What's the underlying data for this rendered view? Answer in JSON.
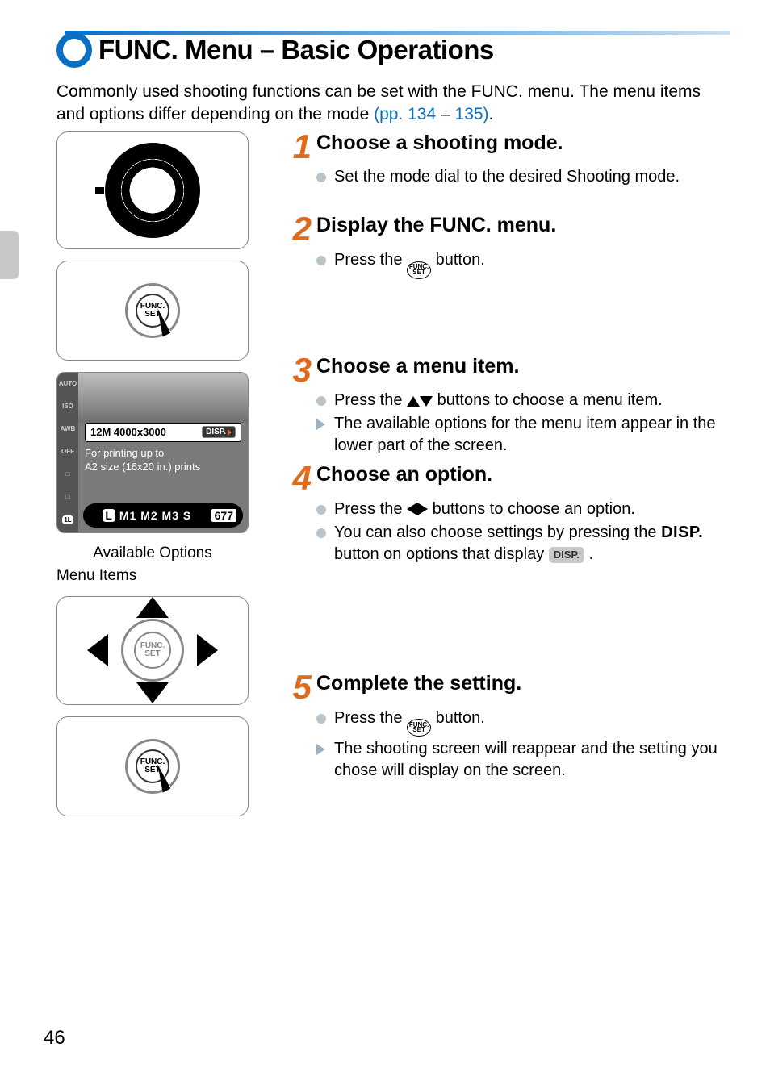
{
  "title": "FUNC. Menu – Basic Operations",
  "intro_a": "Commonly used shooting functions can be set with the FUNC. menu. The menu items and options differ depending on the mode ",
  "link_pp": "(pp. 134",
  "dash": " – ",
  "link_pp2": "135)",
  "period": ".",
  "captions": {
    "available": "Available Options",
    "menu_items": "Menu Items"
  },
  "screen": {
    "res": "12M 4000x3000",
    "disp": "DISP.",
    "msg1": "For printing up to",
    "msg2": "A2 size (16x20 in.) prints",
    "strip": "M1 M2 M3  S",
    "strip_L": "L",
    "count": "677"
  },
  "sidebar": [
    "AUTO",
    "ISO",
    "AWB",
    "OFF",
    "□",
    "□",
    "1L"
  ],
  "steps": {
    "s1": {
      "n": "1",
      "title": "Choose a shooting mode.",
      "b1": "Set the mode dial to the desired Shooting mode."
    },
    "s2": {
      "n": "2",
      "title": "Display the FUNC. menu.",
      "b1a": "Press the ",
      "b1b": " button."
    },
    "s3": {
      "n": "3",
      "title": "Choose a menu item.",
      "b1a": "Press the ",
      "b1b": " buttons to choose a menu item.",
      "b2": "The available options for the menu item appear in the lower part of the screen."
    },
    "s4": {
      "n": "4",
      "title": "Choose an option.",
      "b1a": "Press the ",
      "b1b": " buttons to choose an option.",
      "b2a": "You can also choose settings by pressing the ",
      "b2b": " button on options that display ",
      "disp": "DISP.",
      "chip": "DISP.",
      "b2c": " ."
    },
    "s5": {
      "n": "5",
      "title": "Complete the setting.",
      "b1a": "Press the ",
      "b1b": " button.",
      "b2": "The shooting screen will reappear and the setting you chose will display on the screen."
    }
  },
  "func_label_top": "FUNC.",
  "func_label_bot": "SET",
  "page_number": "46"
}
